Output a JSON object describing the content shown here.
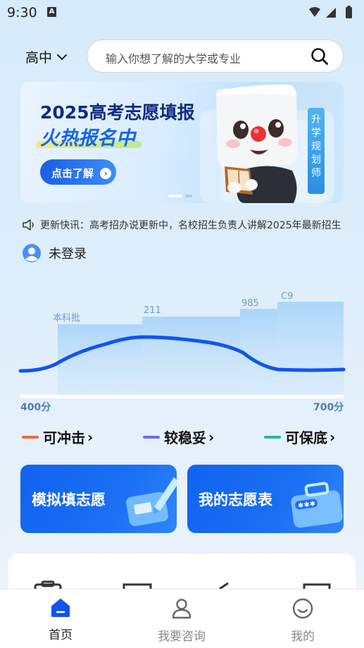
{
  "status_bar": {
    "time": "9:30",
    "notification_icon": "A"
  },
  "header": {
    "grade_label": "高中",
    "search_placeholder": "输入你想了解的大学或专业"
  },
  "banner": {
    "title_line1": "2025高考志愿填报",
    "title_line2": "火热报名中",
    "button_label": "点击了解",
    "side_tag": "升学规划师",
    "page_count": 2,
    "active_page": 1
  },
  "news": {
    "text": "更新快讯：高考招办说更新中，名校招生负责人讲解2025年最新招生"
  },
  "user": {
    "login_status": "未登录"
  },
  "chart_data": {
    "type": "area",
    "x_range_labels": [
      "400分",
      "700分"
    ],
    "bands": [
      {
        "label": "本科批"
      },
      {
        "label": "211"
      },
      {
        "label": "985"
      },
      {
        "label": "C9"
      }
    ],
    "series": [
      {
        "color": "#1254f0"
      }
    ]
  },
  "legend": [
    {
      "label": "可冲击",
      "color": "#f0692c",
      "arrow": "›"
    },
    {
      "label": "较稳妥",
      "color": "#6f6cf0",
      "arrow": "›"
    },
    {
      "label": "可保底",
      "color": "#2ab79a",
      "arrow": "›"
    }
  ],
  "cards": {
    "simulate": {
      "label": "模拟填志愿"
    },
    "my_list": {
      "label": "我的志愿表"
    }
  },
  "tabbar": {
    "items": [
      {
        "label": "首页",
        "icon": "home-icon",
        "active": true
      },
      {
        "label": "我要咨询",
        "icon": "person-icon",
        "active": false
      },
      {
        "label": "我的",
        "icon": "smile-icon",
        "active": false
      }
    ],
    "active_color": "#1254f0",
    "inactive_color": "#888888"
  }
}
